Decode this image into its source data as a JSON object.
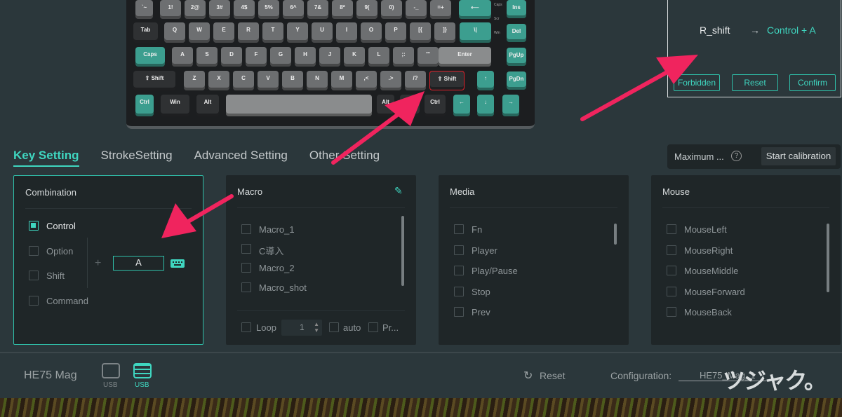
{
  "keyboard": {
    "rows": [
      [
        "`~",
        "1!",
        "2@",
        "3#",
        "4$",
        "5%",
        "6^",
        "7&",
        "8*",
        "9(",
        "0)",
        "-_",
        "=+",
        "⟵"
      ],
      [
        "Tab",
        "Q",
        "W",
        "E",
        "R",
        "T",
        "Y",
        "U",
        "I",
        "O",
        "P",
        "[{",
        "]}",
        "\\|"
      ],
      [
        "Caps",
        "A",
        "S",
        "D",
        "F",
        "G",
        "H",
        "J",
        "K",
        "L",
        ";:",
        "'\"",
        "Enter"
      ],
      [
        "⇧ Shift",
        "Z",
        "X",
        "C",
        "V",
        "B",
        "N",
        "M",
        ",<",
        ".>",
        "/?",
        "⇧ Shift",
        "↑"
      ],
      [
        "Ctrl",
        "Win",
        "Alt",
        "",
        "Alt",
        "Fn",
        "Ctrl",
        "←",
        "↓",
        "→"
      ]
    ],
    "nav": [
      "Ins",
      "Del",
      "PgUp",
      "PgDn"
    ],
    "indicators": [
      "Caps",
      "Scr",
      "Win"
    ],
    "selected_key": "R_shift"
  },
  "popup": {
    "from": "R_shift",
    "arrow": "→",
    "to": "Control + A",
    "buttons": [
      "Forbidden",
      "Reset",
      "Confirm"
    ]
  },
  "tabs": [
    {
      "label": "Key Setting",
      "active": true
    },
    {
      "label": "StrokeSetting"
    },
    {
      "label": "Advanced Setting"
    },
    {
      "label": "Other Setting"
    }
  ],
  "calibration": {
    "label": "Maximum ...",
    "help": "?",
    "button": "Start calibration"
  },
  "combination": {
    "title": "Combination",
    "modifiers": [
      {
        "label": "Control",
        "checked": true
      },
      {
        "label": "Option"
      },
      {
        "label": "Shift"
      },
      {
        "label": "Command"
      }
    ],
    "plus": "+",
    "key_value": "A"
  },
  "macro": {
    "title": "Macro",
    "items": [
      "Macro_1",
      "C導入",
      "Macro_2",
      "Macro_shot"
    ],
    "loop_label": "Loop",
    "loop_value": "1",
    "auto_label": "auto",
    "pr_label": "Pr..."
  },
  "media": {
    "title": "Media",
    "items": [
      "Fn",
      "Player",
      "Play/Pause",
      "Stop",
      "Prev"
    ]
  },
  "mouse": {
    "title": "Mouse",
    "items": [
      "MouseLeft",
      "MouseRight",
      "MouseMiddle",
      "MouseForward",
      "MouseBack"
    ]
  },
  "footer": {
    "device": "HE75 Mag",
    "conn1": "USB",
    "conn2": "USB",
    "reset": "Reset",
    "config_label": "Configuration:",
    "config_value": "HE75_Mag_1",
    "watermark": "ツジャク。"
  },
  "colors": {
    "accent": "#3fd6c0",
    "annotation": "#f0245e",
    "panel": "#1f2628",
    "background": "#2b373b"
  }
}
